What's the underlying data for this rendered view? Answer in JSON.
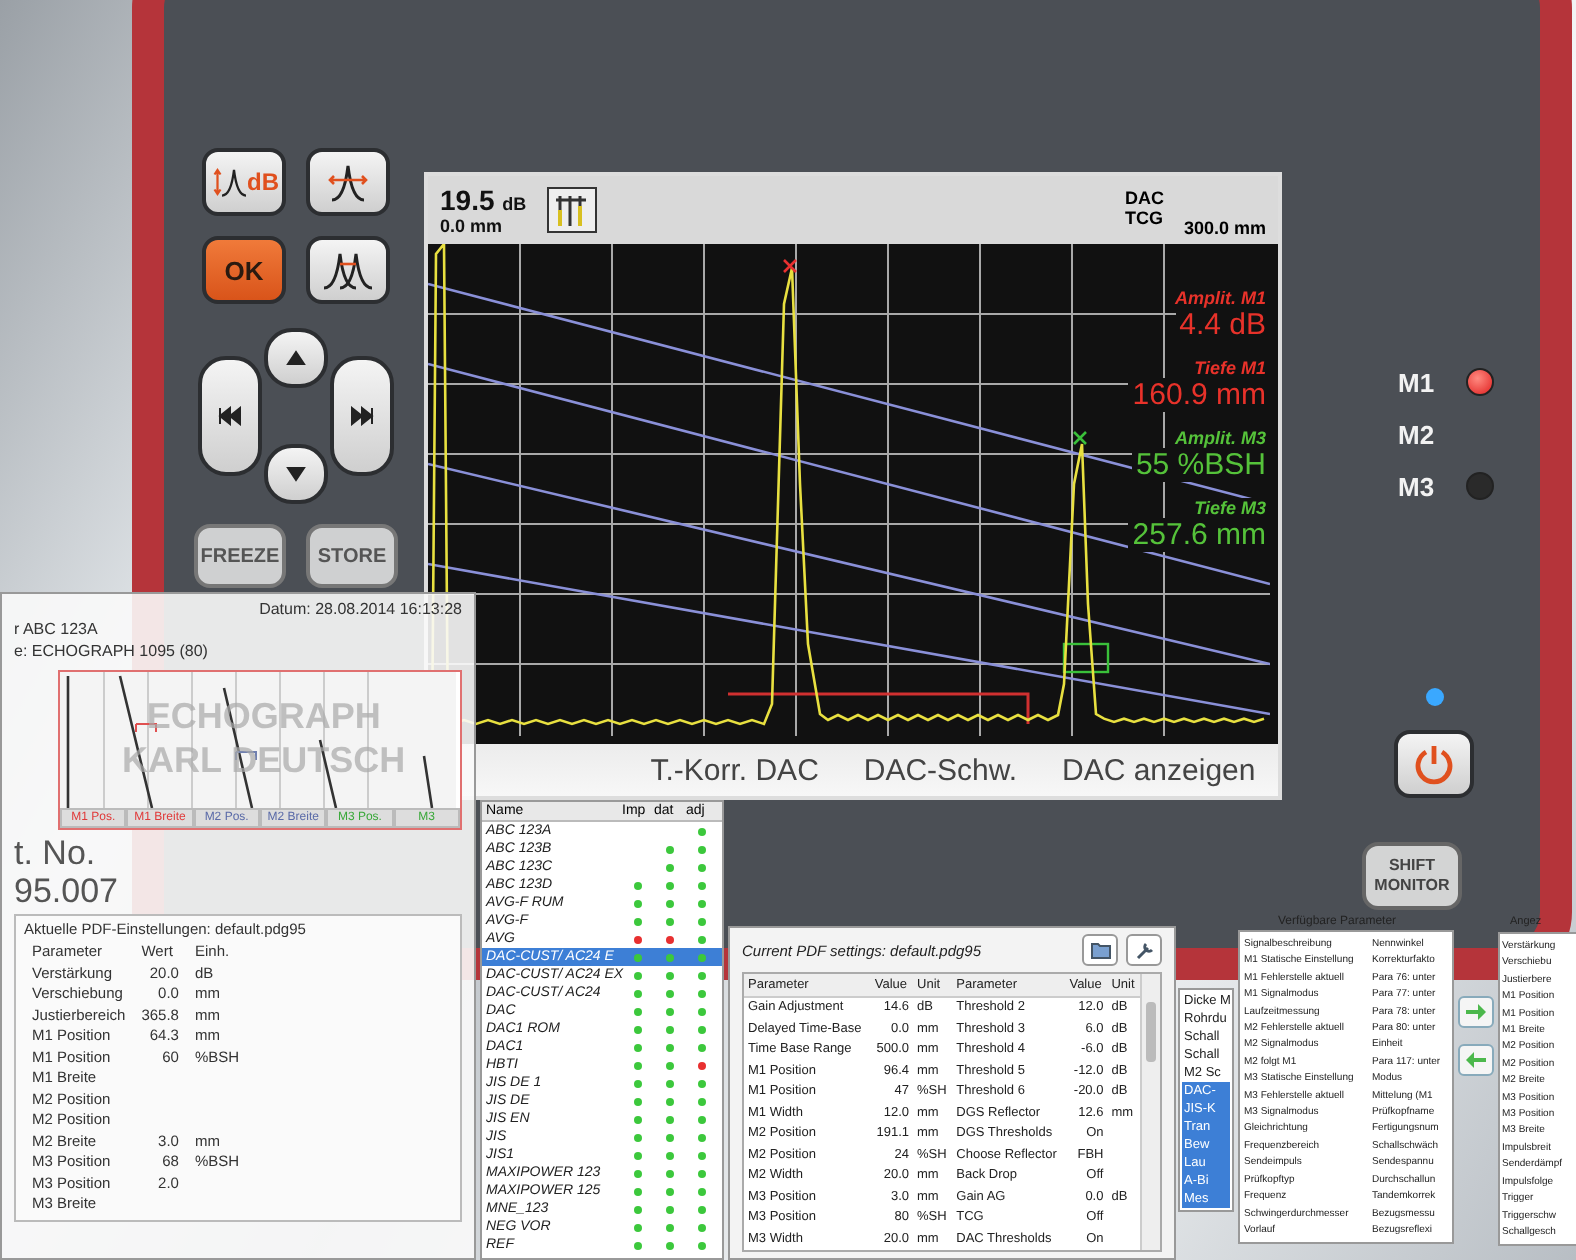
{
  "device": {
    "label": [
      "ECHOGRAPH",
      "KARL DEUTSCH"
    ],
    "keys": [
      {
        "kind": "gain",
        "label": "dB"
      },
      {
        "kind": "gate"
      },
      {
        "kind": "ok",
        "label": "OK"
      },
      {
        "kind": "width"
      }
    ],
    "nav_keys": [
      {
        "kind": "up"
      },
      {
        "kind": "left"
      },
      {
        "kind": "right"
      },
      {
        "kind": "down"
      }
    ],
    "function_keys": [
      "FREEZE",
      "STORE"
    ],
    "marker_keys": [
      {
        "label": "M1",
        "lit": true
      },
      {
        "label": "M2"
      },
      {
        "label": "M3",
        "lit": false
      }
    ],
    "power_led_on": true,
    "shift_key": [
      "SHIFT",
      "MONITOR"
    ]
  },
  "screen": {
    "gain": "19.5",
    "gain_unit": "dB",
    "offset": "0.0 mm",
    "modes": [
      "DAC",
      "TCG"
    ],
    "range": "300.0 mm",
    "readings": [
      {
        "label": "Amplit. M1",
        "value": "4.4 dB",
        "color": "#e8322a"
      },
      {
        "label": "Tiefe M1",
        "value": "160.9 mm",
        "color": "#e8322a"
      },
      {
        "label": "Amplit. M3",
        "value": "55 %BSH",
        "color": "#55c23a"
      },
      {
        "label": "Tiefe M3",
        "value": "257.6 mm",
        "color": "#55c23a"
      }
    ],
    "softkeys": [
      "T.-Korr. DAC",
      "DAC-Schw.",
      "DAC anzeigen"
    ]
  },
  "report_window": {
    "date": "Datum: 28.08.2014 16:13:28",
    "lines": [
      "r ABC 123A",
      "e: ECHOGRAPH 1095 (80)"
    ],
    "mini_tabs": [
      {
        "label": "M1 Pos.",
        "color": "#e03a3a"
      },
      {
        "label": "M1 Breite",
        "color": "#e03a3a"
      },
      {
        "label": "M2 Pos.",
        "color": "#5a6aa8"
      },
      {
        "label": "M2 Breite",
        "color": "#5a6aa8"
      },
      {
        "label": "M3 Pos.",
        "color": "#3aa83a"
      },
      {
        "label": "M3",
        "color": "#3aa83a"
      }
    ],
    "side_text": [
      "t. No.",
      "95.007"
    ],
    "settings_title": "Aktuelle PDF-Einstellungen: default.pdg95",
    "columns": [
      "Parameter",
      "Wert",
      "Einh."
    ],
    "rows": [
      {
        "name": "Verstärkung",
        "value": "20.0",
        "unit": "dB"
      },
      {
        "name": "Verschiebung",
        "value": "0.0",
        "unit": "mm"
      },
      {
        "name": "Justierbereich",
        "value": "365.8",
        "unit": "mm"
      },
      {
        "name": "M1 Position",
        "value": "64.3",
        "unit": "mm"
      },
      {
        "name": "M1 Position",
        "value": "60",
        "unit": "%BSH"
      },
      {
        "name": "M1 Breite"
      },
      {
        "name": "M2 Position"
      },
      {
        "name": "M2 Position"
      },
      {
        "name": "M2 Breite",
        "value": "3.0",
        "unit": "mm"
      },
      {
        "name": "M3 Position",
        "value": "68",
        "unit": "%BSH"
      },
      {
        "name": "M3 Position",
        "value": "2.0"
      },
      {
        "name": "M3 Breite"
      }
    ]
  },
  "probe_window": {
    "columns": [
      "Name",
      "Imp",
      "dat",
      "adj"
    ],
    "items": [
      {
        "name": "ABC 123A",
        "selected": false,
        "dots": [
          {
            "color": "#3cc83c"
          }
        ]
      },
      {
        "name": "ABC 123B",
        "selected": false,
        "dots": [
          {
            "color": "#3cc83c"
          },
          {
            "color": "#3cc83c"
          }
        ]
      },
      {
        "name": "ABC 123C",
        "selected": false,
        "dots": [
          {
            "color": "#3cc83c"
          },
          {
            "color": "#3cc83c"
          }
        ]
      },
      {
        "name": "ABC 123D",
        "selected": false,
        "dots": [
          {
            "color": "#3cc83c"
          },
          {
            "color": "#3cc83c"
          },
          {
            "color": "#3cc83c"
          }
        ]
      },
      {
        "name": "AVG-F RUM",
        "selected": false,
        "dots": [
          {
            "color": "#3cc83c"
          },
          {
            "color": "#3cc83c"
          },
          {
            "color": "#3cc83c"
          }
        ]
      },
      {
        "name": "AVG-F",
        "selected": false,
        "dots": [
          {
            "color": "#3cc83c"
          },
          {
            "color": "#3cc83c"
          },
          {
            "color": "#3cc83c"
          }
        ]
      },
      {
        "name": "AVG",
        "selected": false,
        "dots": [
          {
            "color": "#e83030"
          },
          {
            "color": "#e83030"
          },
          {
            "color": "#3cc83c"
          }
        ]
      },
      {
        "name": "DAC-CUST/ AC24 E",
        "selected": true,
        "dots": [
          {
            "color": "#3cc83c"
          },
          {
            "color": "#3cc83c"
          },
          {
            "color": "#3cc83c"
          }
        ]
      },
      {
        "name": "DAC-CUST/ AC24 EX",
        "selected": false,
        "dots": [
          {
            "color": "#3cc83c"
          },
          {
            "color": "#3cc83c"
          },
          {
            "color": "#3cc83c"
          }
        ]
      },
      {
        "name": "DAC-CUST/ AC24",
        "selected": false,
        "dots": [
          {
            "color": "#3cc83c"
          },
          {
            "color": "#3cc83c"
          },
          {
            "color": "#3cc83c"
          }
        ]
      },
      {
        "name": "DAC",
        "selected": false,
        "dots": [
          {
            "color": "#3cc83c"
          },
          {
            "color": "#3cc83c"
          },
          {
            "color": "#3cc83c"
          }
        ]
      },
      {
        "name": "DAC1 ROM",
        "selected": false,
        "dots": [
          {
            "color": "#3cc83c"
          },
          {
            "color": "#3cc83c"
          },
          {
            "color": "#3cc83c"
          }
        ]
      },
      {
        "name": "DAC1",
        "selected": false,
        "dots": [
          {
            "color": "#3cc83c"
          },
          {
            "color": "#3cc83c"
          },
          {
            "color": "#3cc83c"
          }
        ]
      },
      {
        "name": "HBTI",
        "selected": false,
        "dots": [
          {
            "color": "#3cc83c"
          },
          {
            "color": "#3cc83c"
          },
          {
            "color": "#e83030"
          }
        ]
      },
      {
        "name": "JIS DE 1",
        "selected": false,
        "dots": [
          {
            "color": "#3cc83c"
          },
          {
            "color": "#3cc83c"
          },
          {
            "color": "#3cc83c"
          }
        ]
      },
      {
        "name": "JIS DE",
        "selected": false,
        "dots": [
          {
            "color": "#3cc83c"
          },
          {
            "color": "#3cc83c"
          },
          {
            "color": "#3cc83c"
          }
        ]
      },
      {
        "name": "JIS EN",
        "selected": false,
        "dots": [
          {
            "color": "#3cc83c"
          },
          {
            "color": "#3cc83c"
          },
          {
            "color": "#3cc83c"
          }
        ]
      },
      {
        "name": "JIS",
        "selected": false,
        "dots": [
          {
            "color": "#3cc83c"
          },
          {
            "color": "#3cc83c"
          },
          {
            "color": "#3cc83c"
          }
        ]
      },
      {
        "name": "JIS1",
        "selected": false,
        "dots": [
          {
            "color": "#3cc83c"
          },
          {
            "color": "#3cc83c"
          },
          {
            "color": "#3cc83c"
          }
        ]
      },
      {
        "name": "MAXIPOWER 123",
        "selected": false,
        "dots": [
          {
            "color": "#3cc83c"
          },
          {
            "color": "#3cc83c"
          },
          {
            "color": "#3cc83c"
          }
        ]
      },
      {
        "name": "MAXIPOWER 125",
        "selected": false,
        "dots": [
          {
            "color": "#3cc83c"
          },
          {
            "color": "#3cc83c"
          },
          {
            "color": "#3cc83c"
          }
        ]
      },
      {
        "name": "MNE_123",
        "selected": false,
        "dots": [
          {
            "color": "#3cc83c"
          },
          {
            "color": "#3cc83c"
          },
          {
            "color": "#3cc83c"
          }
        ]
      },
      {
        "name": "NEG VOR",
        "selected": false,
        "dots": [
          {
            "color": "#3cc83c"
          },
          {
            "color": "#3cc83c"
          },
          {
            "color": "#3cc83c"
          }
        ]
      },
      {
        "name": "REF",
        "selected": false,
        "dots": [
          {
            "color": "#3cc83c"
          },
          {
            "color": "#3cc83c"
          },
          {
            "color": "#3cc83c"
          }
        ]
      }
    ]
  },
  "settings_window": {
    "title": "Current PDF settings: default.pdg95",
    "columns": [
      "Parameter",
      "Value",
      "Unit",
      "Parameter",
      "Value",
      "Unit"
    ],
    "rows": [
      {
        "p1": "Gain Adjustment",
        "v1": "14.6",
        "u1": "dB",
        "p2": "Threshold 2",
        "v2": "12.0",
        "u2": "dB"
      },
      {
        "p1": "Delayed Time-Base",
        "v1": "0.0",
        "u1": "mm",
        "p2": "Threshold 3",
        "v2": "6.0",
        "u2": "dB"
      },
      {
        "p1": "Time Base Range",
        "v1": "500.0",
        "u1": "mm",
        "p2": "Threshold 4",
        "v2": "-6.0",
        "u2": "dB"
      },
      {
        "p1": "M1 Position",
        "v1": "96.4",
        "u1": "mm",
        "p2": "Threshold 5",
        "v2": "-12.0",
        "u2": "dB"
      },
      {
        "p1": "M1 Position",
        "v1": "47",
        "u1": "%SH",
        "p2": "Threshold 6",
        "v2": "-20.0",
        "u2": "dB"
      },
      {
        "p1": "M1 Width",
        "v1": "12.0",
        "u1": "mm",
        "p2": "DGS Reflector",
        "v2": "12.6",
        "u2": "mm"
      },
      {
        "p1": "M2 Position",
        "v1": "191.1",
        "u1": "mm",
        "p2": "DGS Thresholds",
        "v2": "On"
      },
      {
        "p1": "M2 Position",
        "v1": "24",
        "u1": "%SH",
        "p2": "Choose Reflector",
        "v2": "FBH"
      },
      {
        "p1": "M2 Width",
        "v1": "20.0",
        "u1": "mm",
        "p2": "Back Drop",
        "v2": "Off"
      },
      {
        "p1": "M3 Position",
        "v1": "3.0",
        "u1": "mm",
        "p2": "Gain AG",
        "v2": "0.0",
        "u2": "dB"
      },
      {
        "p1": "M3 Position",
        "v1": "80",
        "u1": "%SH",
        "p2": "TCG",
        "v2": "Off"
      },
      {
        "p1": "M3 Width",
        "v1": "20.0",
        "u1": "mm",
        "p2": "DAC Thresholds",
        "v2": "On"
      }
    ]
  },
  "picker_window": {
    "left_list": [
      {
        "label": "Dicke M",
        "selected": false
      },
      {
        "label": "Rohrdu",
        "selected": false
      },
      {
        "label": "Schall",
        "selected": false
      },
      {
        "label": "Schall",
        "selected": false
      },
      {
        "label": "M2 Sc",
        "selected": false
      },
      {
        "label": "DAC-",
        "selected": true
      },
      {
        "label": "JIS-K",
        "selected": true
      },
      {
        "label": "Tran",
        "selected": true
      },
      {
        "label": "Bew",
        "selected": true
      },
      {
        "label": "Lau",
        "selected": true
      },
      {
        "label": "A-Bi",
        "selected": true
      },
      {
        "label": "Mes",
        "selected": true
      }
    ],
    "title": "Verfügbare Parameter",
    "rows": [
      [
        "Signalbeschreibung",
        "Nennwinkel"
      ],
      [
        "M1 Statische Einstellung",
        "Korrekturfakto"
      ],
      [
        "M1 Fehlerstelle aktuell",
        "Para 76: unter"
      ],
      [
        "M1 Signalmodus",
        "Para 77: unter"
      ],
      [
        "Laufzeitmessung",
        "Para 78: unter"
      ],
      [
        "M2 Fehlerstelle aktuell",
        "Para 80: unter"
      ],
      [
        "M2 Signalmodus",
        "Einheit"
      ],
      [
        "M2 folgt M1",
        "Para 117: unter"
      ],
      [
        "M3 Statische Einstellung",
        "Modus"
      ],
      [
        "M3 Fehlerstelle aktuell",
        "Mittelung (M1"
      ],
      [
        "M3 Signalmodus",
        "Prüfkopfname"
      ],
      [
        "Gleichrichtung",
        "Fertigungsnum"
      ],
      [
        "Frequenzbereich",
        "Schallschwäch"
      ],
      [
        "Sendeimpuls",
        "Sendespannu"
      ],
      [
        "Prüfkopftyp",
        "Durchschallun"
      ],
      [
        "Frequenz",
        "Tandemkorrek"
      ],
      [
        "Schwingerdurchmesser",
        "Bezugsmessu"
      ],
      [
        "Vorlauf",
        "Bezugsreflexi"
      ]
    ],
    "shown_title": "Angez",
    "shown_list": [
      "Verstärkung",
      "Verschiebu",
      "Justierbere",
      "M1 Position",
      "M1 Position",
      "M1 Breite",
      "M2 Position",
      "M2 Position",
      "M2 Breite",
      "M3 Position",
      "M3 Position",
      "M3 Breite",
      "Impulsbreit",
      "Senderdämpf",
      "Impulsfolge",
      "Trigger",
      "Triggerschw",
      "Schallgesch"
    ]
  }
}
